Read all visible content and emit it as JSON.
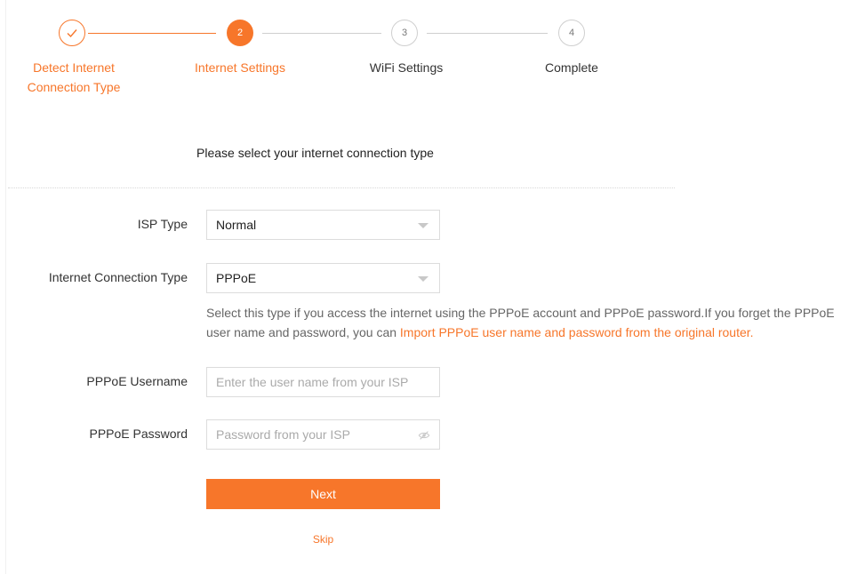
{
  "accent_color": "#f7762a",
  "steps": [
    {
      "number": "",
      "label_line1": "Detect Internet",
      "label_line2": "Connection Type",
      "state": "done",
      "icon": "check-icon"
    },
    {
      "number": "2",
      "label_line1": "Internet Settings",
      "label_line2": "",
      "state": "active"
    },
    {
      "number": "3",
      "label_line1": "WiFi Settings",
      "label_line2": "",
      "state": "pending"
    },
    {
      "number": "4",
      "label_line1": "Complete",
      "label_line2": "",
      "state": "pending"
    }
  ],
  "prompt": "Please select your internet connection type",
  "form": {
    "isp_type": {
      "label": "ISP Type",
      "value": "Normal"
    },
    "connection_type": {
      "label": "Internet Connection Type",
      "value": "PPPoE"
    },
    "help_text": "Select this type if you access the internet using the PPPoE account and PPPoE password.If you forget the PPPoE user name and password, you can ",
    "help_link": "Import PPPoE user name and password from the original router.",
    "username": {
      "label": "PPPoE Username",
      "placeholder": "Enter the user name from your ISP",
      "value": ""
    },
    "password": {
      "label": "PPPoE Password",
      "placeholder": "Password from your ISP",
      "value": "",
      "icon": "eye-hidden-icon"
    }
  },
  "actions": {
    "next_label": "Next",
    "skip_label": "Skip"
  }
}
